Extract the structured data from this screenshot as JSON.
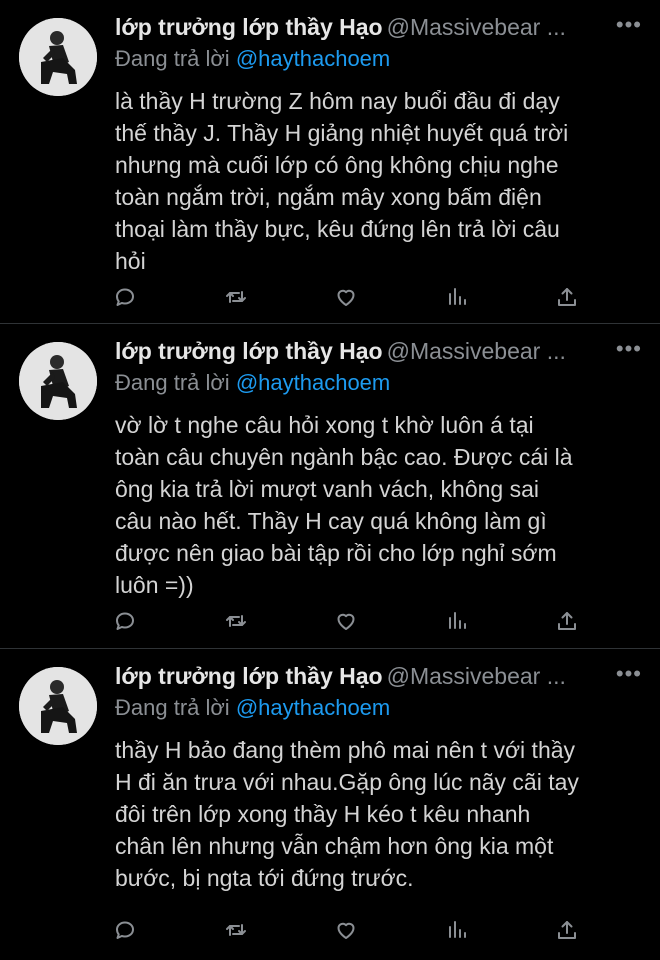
{
  "tweets": [
    {
      "author_name": "lớp trưởng lớp thầy Hạo",
      "author_handle": "@Massivebear ...",
      "reply_prefix": "Đang trả lời",
      "reply_to": "@haythachoem",
      "text": "là thầy H trường Z hôm nay buổi đầu đi dạy\nthế thầy J. Thầy H giảng nhiệt huyết quá trời\nnhưng mà cuối lớp có ông không chịu nghe\ntoàn ngắm trời, ngắm mây xong bấm điện\nthoại làm thầy bực, kêu đứng lên trả lời câu\nhỏi"
    },
    {
      "author_name": "lớp trưởng lớp thầy Hạo",
      "author_handle": "@Massivebear ...",
      "reply_prefix": "Đang trả lời",
      "reply_to": "@haythachoem",
      "text": "vờ lờ t nghe câu hỏi xong t khờ luôn á tại\ntoàn câu chuyên ngành bậc cao. Được cái là\nông kia trả lời mượt vanh vách, không sai\ncâu nào hết. Thầy H cay quá không làm gì\nđược nên giao bài tập rồi cho lớp nghỉ sớm\nluôn =))"
    },
    {
      "author_name": "lớp trưởng lớp thầy Hạo",
      "author_handle": "@Massivebear ...",
      "reply_prefix": "Đang trả lời",
      "reply_to": "@haythachoem",
      "text": "thầy H bảo đang thèm phô mai nên t với thầy\nH đi ăn trưa với nhau.Gặp ông lúc nãy cãi tay\nđôi trên lớp xong thầy H kéo t kêu nhanh\nchân lên nhưng vẫn chậm hơn ông kia một\nbước, bị ngta tới đứng trước."
    }
  ],
  "more_glyph": "•••",
  "icons": [
    "reply-icon",
    "retweet-icon",
    "like-icon",
    "analytics-icon",
    "share-icon"
  ],
  "colors": {
    "background": "#000000",
    "mention": "#1d9bf0",
    "muted": "#8b8f94"
  }
}
